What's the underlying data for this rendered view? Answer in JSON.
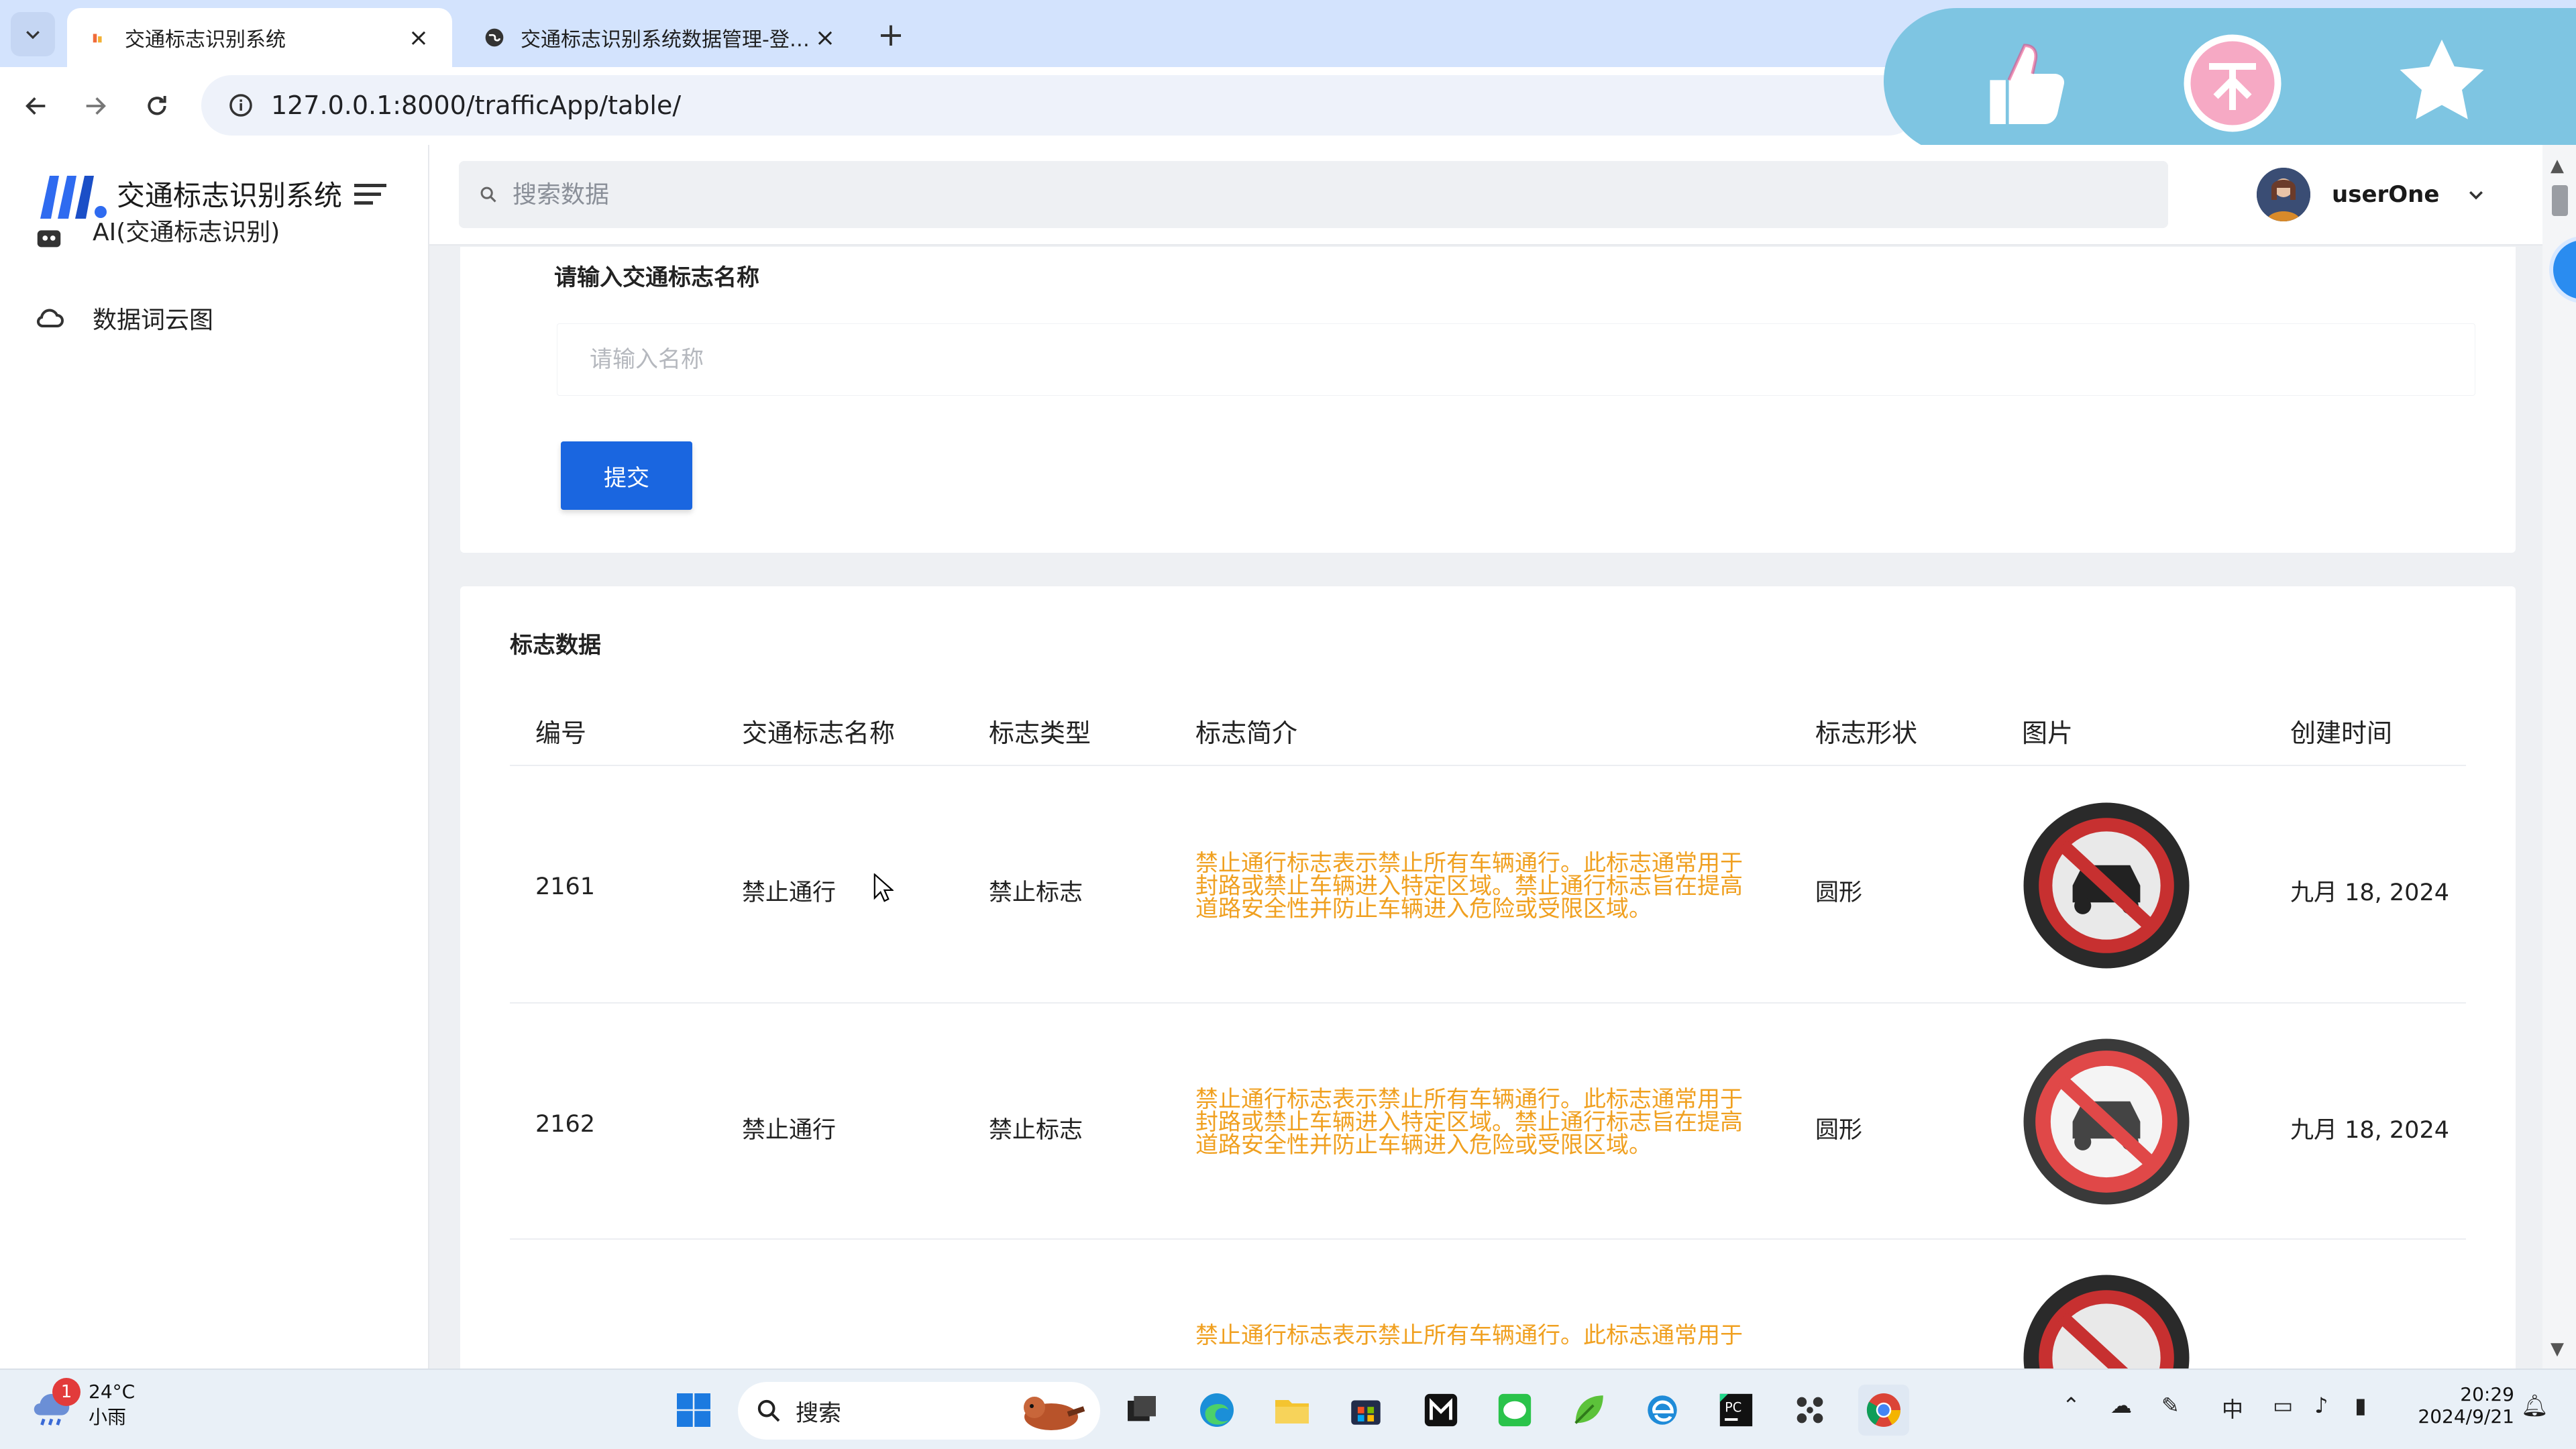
{
  "browser": {
    "tabs": [
      {
        "title": "交通标志识别系统",
        "active": true
      },
      {
        "title": "交通标志识别系统数据管理-登…",
        "active": false
      }
    ],
    "url": "127.0.0.1:8000/trafficApp/table/"
  },
  "sidebar": {
    "app_title": "交通标志识别系统",
    "items": [
      {
        "label": "AI(交通标志识别)",
        "icon": "robot-icon"
      },
      {
        "label": "数据词云图",
        "icon": "cloud-icon"
      }
    ]
  },
  "header": {
    "search_placeholder": "搜索数据",
    "user_name": "userOne"
  },
  "form": {
    "label": "请输入交通标志名称",
    "placeholder": "请输入名称",
    "submit_label": "提交"
  },
  "table": {
    "title": "标志数据",
    "columns": [
      "编号",
      "交通标志名称",
      "标志类型",
      "标志简介",
      "标志形状",
      "图片",
      "创建时间"
    ],
    "rows": [
      {
        "id": "2161",
        "name": "禁止通行",
        "type": "禁止标志",
        "desc_lines": [
          "禁止通行标志表示禁止所有车辆通行。此标志通常用于",
          "封路或禁止车辆进入特定区域。禁止通行标志旨在提高",
          "道路安全性并防止车辆进入危险或受限区域。"
        ],
        "shape": "圆形",
        "created": "九月 18, 2024"
      },
      {
        "id": "2162",
        "name": "禁止通行",
        "type": "禁止标志",
        "desc_lines": [
          "禁止通行标志表示禁止所有车辆通行。此标志通常用于",
          "封路或禁止车辆进入特定区域。禁止通行标志旨在提高",
          "道路安全性并防止车辆进入危险或受限区域。"
        ],
        "shape": "圆形",
        "created": "九月 18, 2024"
      },
      {
        "desc_lines": [
          "禁止通行标志表示禁止所有车辆通行。此标志通常用于"
        ]
      }
    ]
  },
  "taskbar": {
    "weather_temp": "24°C",
    "weather_cond": "小雨",
    "weather_badge": "1",
    "search_label": "搜索",
    "ime": "中",
    "time": "20:29",
    "date": "2024/9/21"
  },
  "colors": {
    "accent": "#1a66e0",
    "desc_text": "#f0a020",
    "overlay": "#7ec5e2"
  }
}
